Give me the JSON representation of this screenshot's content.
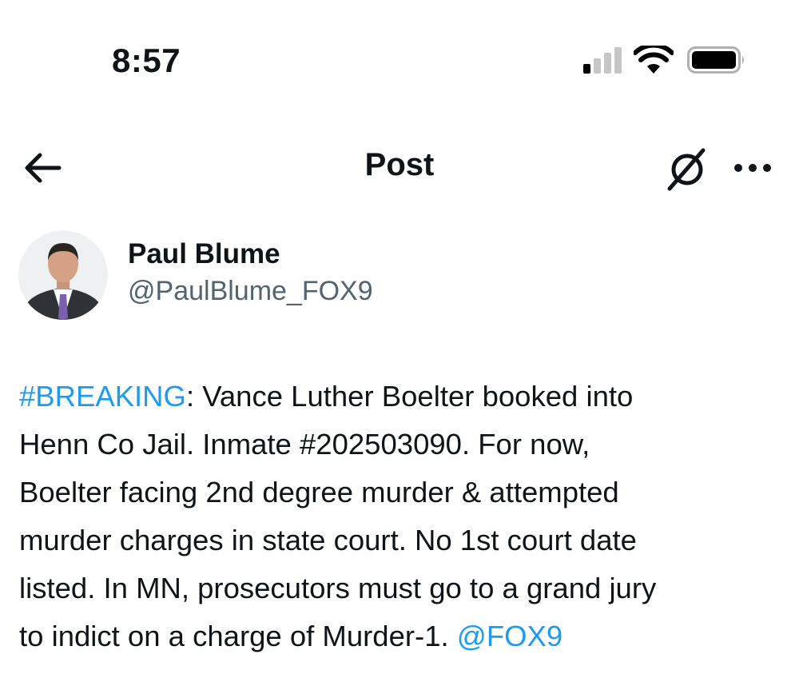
{
  "status_bar": {
    "time": "8:57",
    "icons": [
      "cellular-signal-icon",
      "wifi-icon",
      "battery-icon"
    ]
  },
  "header": {
    "title": "Post",
    "icons": [
      "back-arrow-icon",
      "grok-icon",
      "more-options-icon"
    ]
  },
  "author": {
    "name": "Paul Blume",
    "handle": "@PaulBlume_FOX9"
  },
  "post": {
    "hashtag": "#BREAKING",
    "line1_rest": ": Vance Luther Boelter booked into",
    "line2": "Henn Co Jail. Inmate #202503090. For now,",
    "line3": "Boelter facing 2nd degree murder & attempted",
    "line4": "murder charges in state court. No 1st court date",
    "line5": "listed. In MN, prosecutors must go to a grand jury",
    "line6_prefix": "to indict on a charge of Murder-1. ",
    "mention": "@FOX9"
  },
  "colors": {
    "link": "#1d9bf0",
    "text": "#0f1419",
    "secondary": "#536471"
  }
}
